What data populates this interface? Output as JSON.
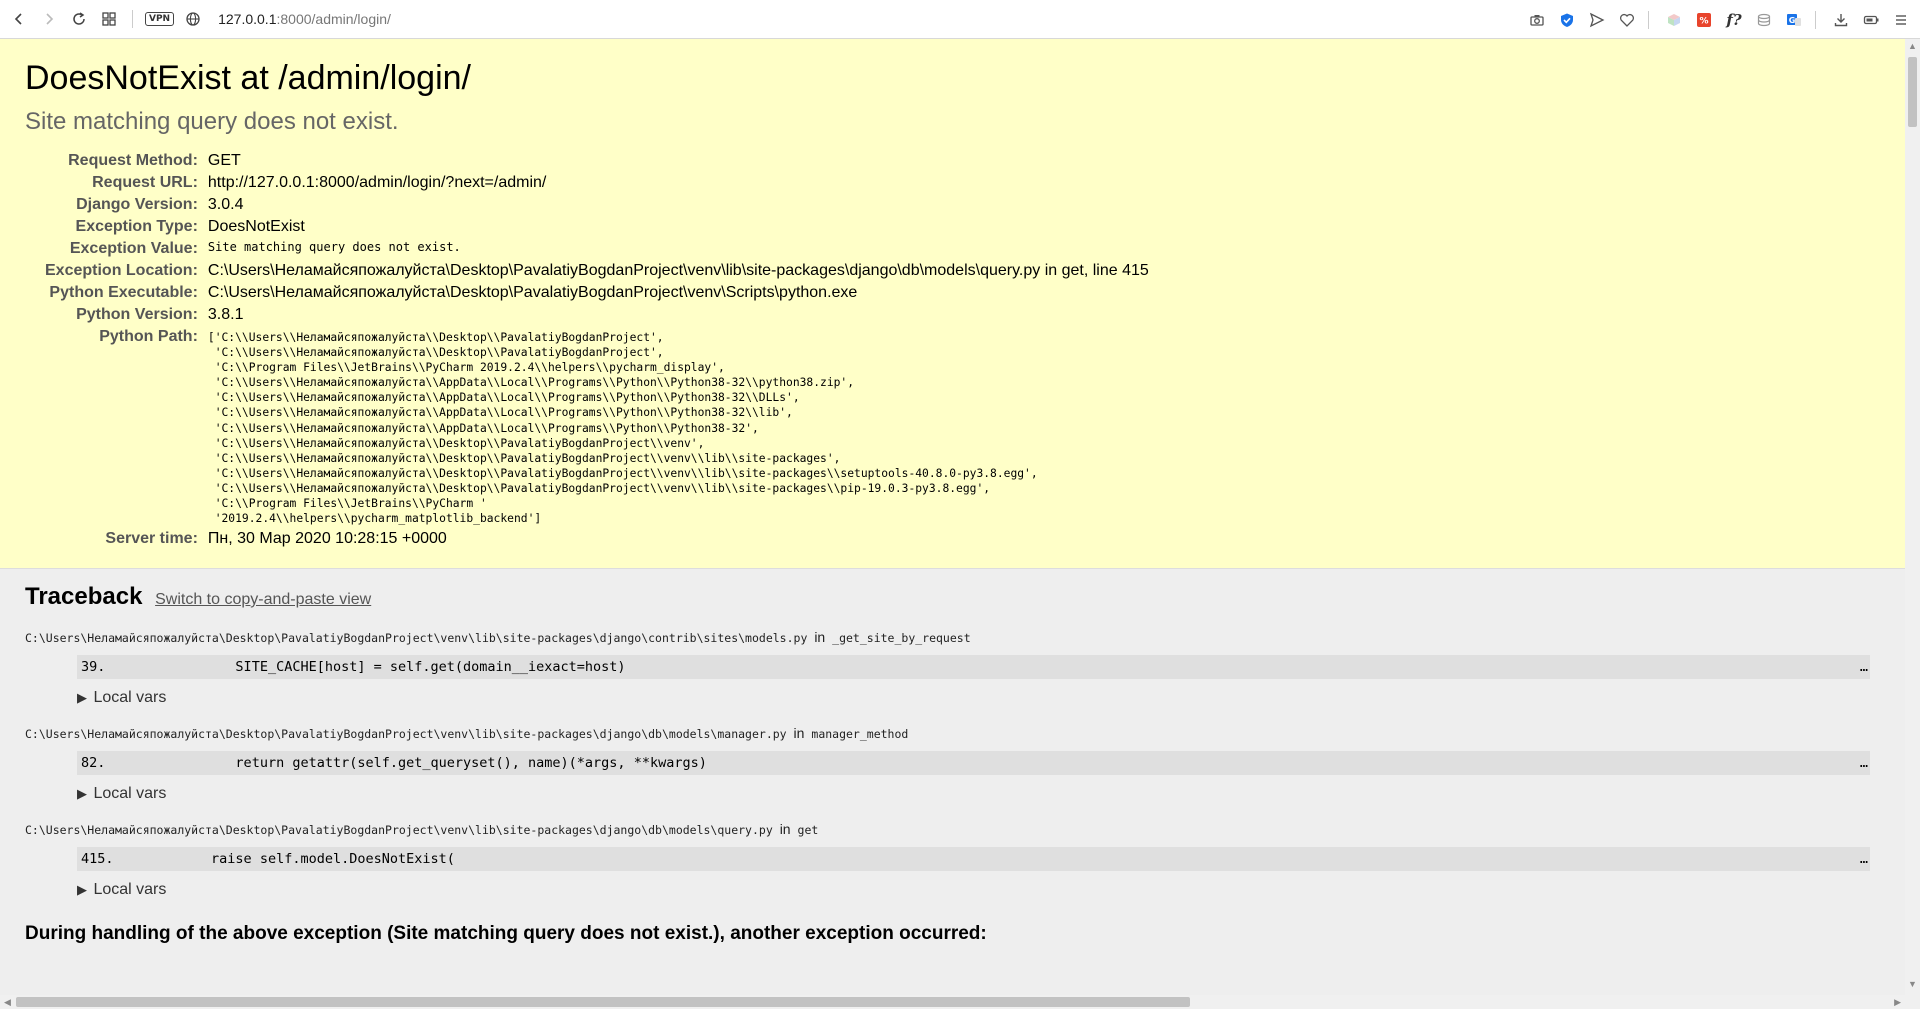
{
  "browser": {
    "url_host": "127.0.0.1",
    "url_rest": ":8000/admin/login/",
    "vpn_label": "VPN",
    "icons": [
      "back-icon",
      "forward-icon",
      "reload-icon",
      "grid-icon",
      "vpn-badge",
      "globe-icon",
      "camera-icon",
      "shield-icon",
      "send-icon",
      "heart-icon",
      "cube-icon",
      "percent-icon",
      "function-icon",
      "layers-icon",
      "translate-icon",
      "download-icon",
      "battery-icon",
      "menu-icon"
    ],
    "ext_fx": "f?"
  },
  "error": {
    "title": "DoesNotExist at /admin/login/",
    "subtitle": "Site matching query does not exist."
  },
  "meta": [
    {
      "label": "Request Method:",
      "value": "GET"
    },
    {
      "label": "Request URL:",
      "value": "http://127.0.0.1:8000/admin/login/?next=/admin/"
    },
    {
      "label": "Django Version:",
      "value": "3.0.4"
    },
    {
      "label": "Exception Type:",
      "value": "DoesNotExist"
    },
    {
      "label": "Exception Value:",
      "value": "Site matching query does not exist."
    },
    {
      "label": "Exception Location:",
      "value": "C:\\Users\\Неламайсяпожалуйста\\Desktop\\PavalatiyBogdanProject\\venv\\lib\\site-packages\\django\\db\\models\\query.py in get, line 415"
    },
    {
      "label": "Python Executable:",
      "value": "C:\\Users\\Неламайсяпожалуйста\\Desktop\\PavalatiyBogdanProject\\venv\\Scripts\\python.exe"
    },
    {
      "label": "Python Version:",
      "value": "3.8.1"
    },
    {
      "label": "Python Path:",
      "value": "['C:\\\\Users\\\\Неламайсяпожалуйста\\\\Desktop\\\\PavalatiyBogdanProject',\n 'C:\\\\Users\\\\Неламайсяпожалуйста\\\\Desktop\\\\PavalatiyBogdanProject',\n 'C:\\\\Program Files\\\\JetBrains\\\\PyCharm 2019.2.4\\\\helpers\\\\pycharm_display',\n 'C:\\\\Users\\\\Неламайсяпожалуйста\\\\AppData\\\\Local\\\\Programs\\\\Python\\\\Python38-32\\\\python38.zip',\n 'C:\\\\Users\\\\Неламайсяпожалуйста\\\\AppData\\\\Local\\\\Programs\\\\Python\\\\Python38-32\\\\DLLs',\n 'C:\\\\Users\\\\Неламайсяпожалуйста\\\\AppData\\\\Local\\\\Programs\\\\Python\\\\Python38-32\\\\lib',\n 'C:\\\\Users\\\\Неламайсяпожалуйста\\\\AppData\\\\Local\\\\Programs\\\\Python\\\\Python38-32',\n 'C:\\\\Users\\\\Неламайсяпожалуйста\\\\Desktop\\\\PavalatiyBogdanProject\\\\venv',\n 'C:\\\\Users\\\\Неламайсяпожалуйста\\\\Desktop\\\\PavalatiyBogdanProject\\\\venv\\\\lib\\\\site-packages',\n 'C:\\\\Users\\\\Неламайсяпожалуйста\\\\Desktop\\\\PavalatiyBogdanProject\\\\venv\\\\lib\\\\site-packages\\\\setuptools-40.8.0-py3.8.egg',\n 'C:\\\\Users\\\\Неламайсяпожалуйста\\\\Desktop\\\\PavalatiyBogdanProject\\\\venv\\\\lib\\\\site-packages\\\\pip-19.0.3-py3.8.egg',\n 'C:\\\\Program Files\\\\JetBrains\\\\PyCharm '\n '2019.2.4\\\\helpers\\\\pycharm_matplotlib_backend']"
    },
    {
      "label": "Server time:",
      "value": "Пн, 30 Мар 2020 10:28:15 +0000"
    }
  ],
  "traceback": {
    "heading": "Traceback",
    "switch_link": "Switch to copy-and-paste view",
    "local_vars_label": "Local vars",
    "in_word": "in",
    "frames": [
      {
        "file": "C:\\Users\\Неламайсяпожалуйста\\Desktop\\PavalatiyBogdanProject\\venv\\lib\\site-packages\\django\\contrib\\sites\\models.py",
        "func": "_get_site_by_request",
        "line_no": "39.",
        "code": "                SITE_CACHE[host] = self.get(domain__iexact=host)",
        "ellipsis": "…"
      },
      {
        "file": "C:\\Users\\Неламайсяпожалуйста\\Desktop\\PavalatiyBogdanProject\\venv\\lib\\site-packages\\django\\db\\models\\manager.py",
        "func": "manager_method",
        "line_no": "82.",
        "code": "                return getattr(self.get_queryset(), name)(*args, **kwargs)",
        "ellipsis": "…"
      },
      {
        "file": "C:\\Users\\Неламайсяпожалуйста\\Desktop\\PavalatiyBogdanProject\\venv\\lib\\site-packages\\django\\db\\models\\query.py",
        "func": "get",
        "line_no": "415.",
        "code": "            raise self.model.DoesNotExist(",
        "ellipsis": "…"
      }
    ],
    "during_text": "During handling of the above exception (Site matching query does not exist.), another exception occurred:"
  }
}
